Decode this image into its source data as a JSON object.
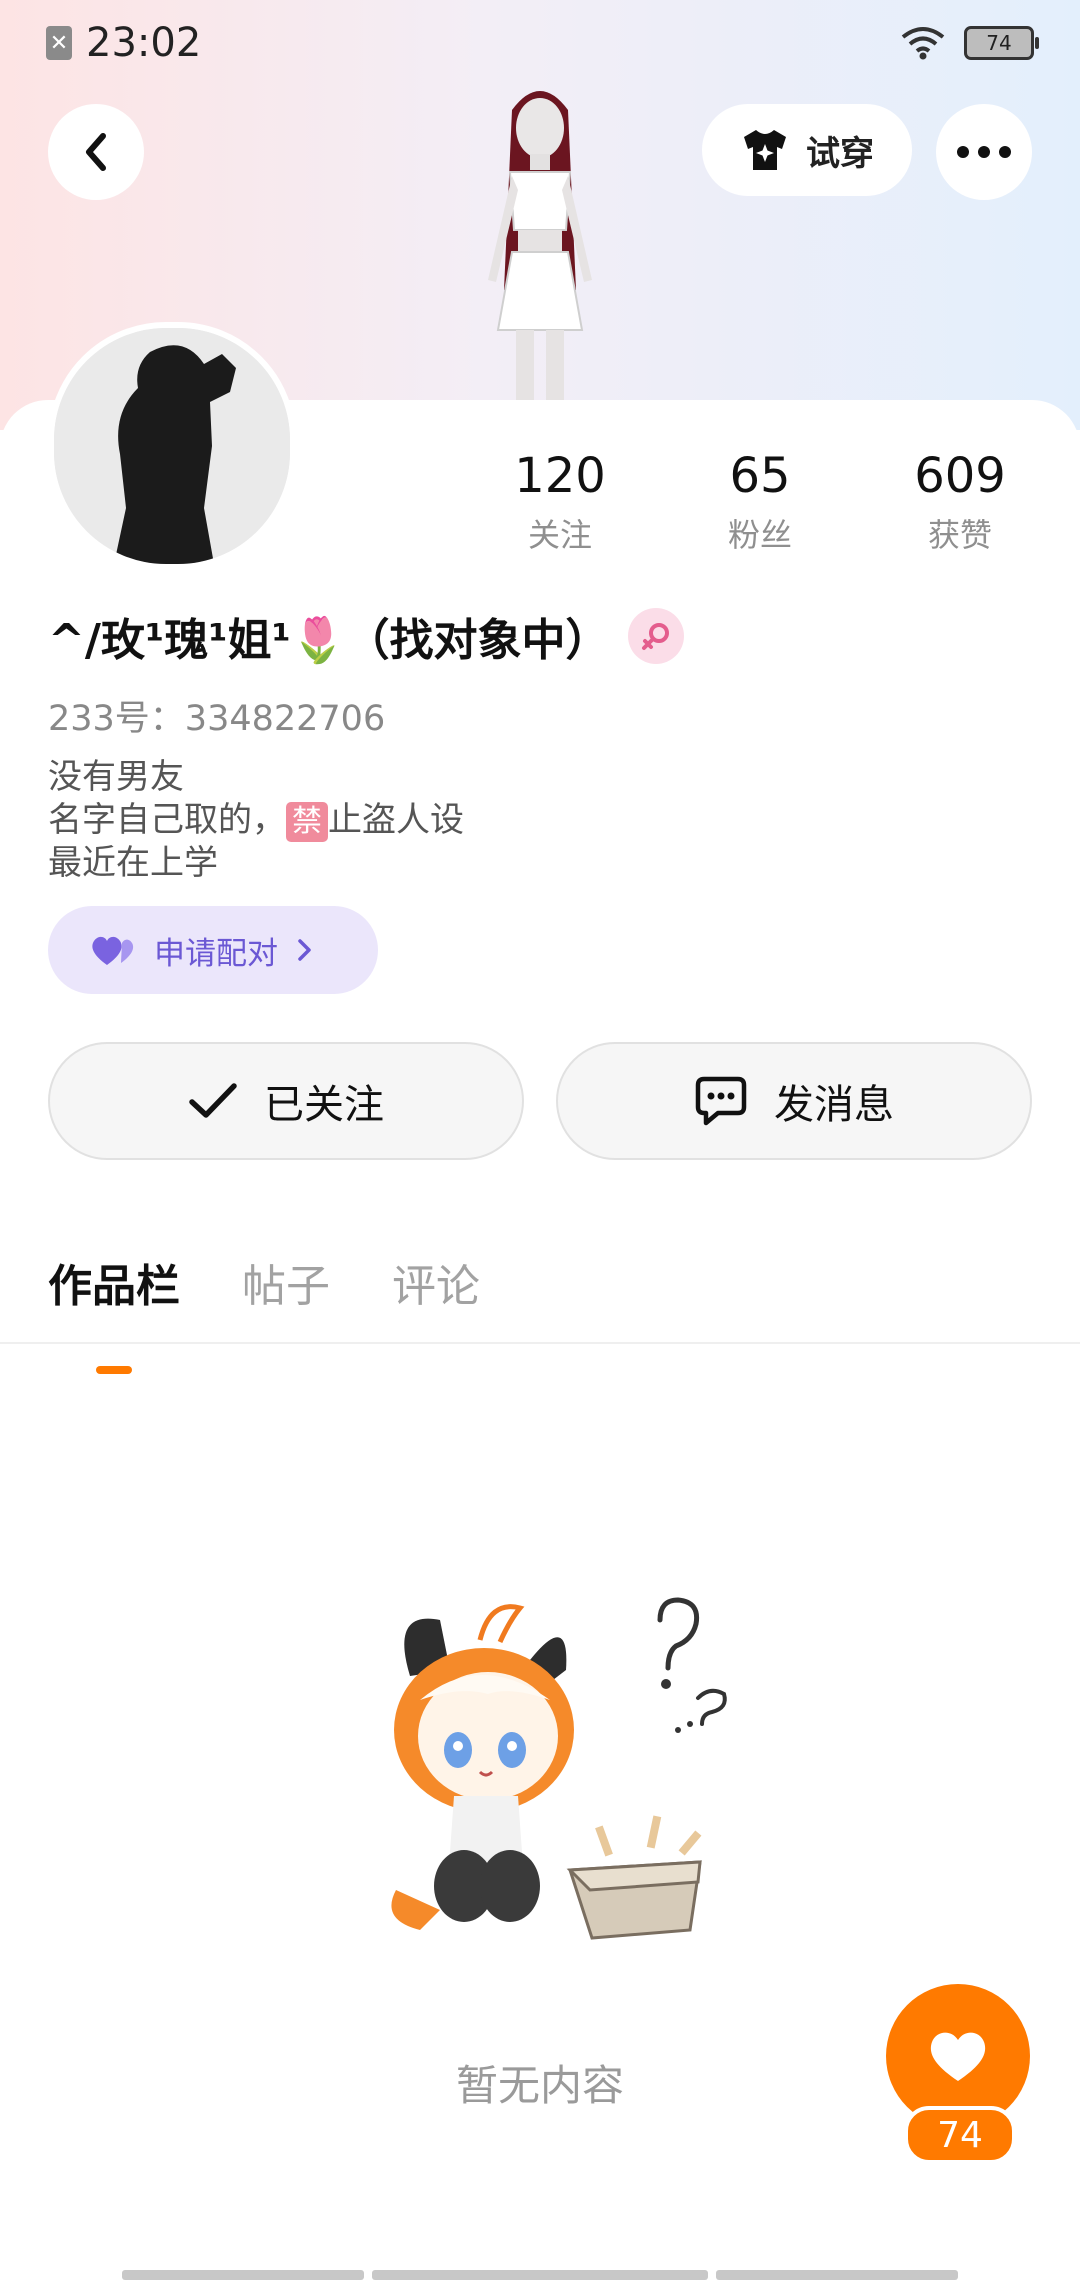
{
  "status_bar": {
    "time": "23:02",
    "battery": "74"
  },
  "header": {
    "try_on_label": "试穿"
  },
  "stats": [
    {
      "value": "120",
      "label": "关注"
    },
    {
      "value": "65",
      "label": "粉丝"
    },
    {
      "value": "609",
      "label": "获赞"
    }
  ],
  "profile": {
    "name": "^/玫¹瑰¹姐¹🌷（找对象中）",
    "uid": "233号：334822706",
    "bio_line1": "没有男友",
    "bio_line2_pre": "名字自己取的，",
    "bio_ban_char": "禁",
    "bio_line2_post": "止盗人设",
    "bio_line3": "最近在上学"
  },
  "match_button": {
    "label": "申请配对"
  },
  "actions": {
    "follow_label": "已关注",
    "message_label": "发消息"
  },
  "tabs": [
    "作品栏",
    "帖子",
    "评论"
  ],
  "empty_state": {
    "text": "暂无内容"
  },
  "like_fab": {
    "count": "74"
  },
  "colors": {
    "accent": "#ff7a00",
    "match_bg": "#ebe6fb",
    "match_text": "#6b58d4",
    "gender_bg": "#fbdde8"
  }
}
